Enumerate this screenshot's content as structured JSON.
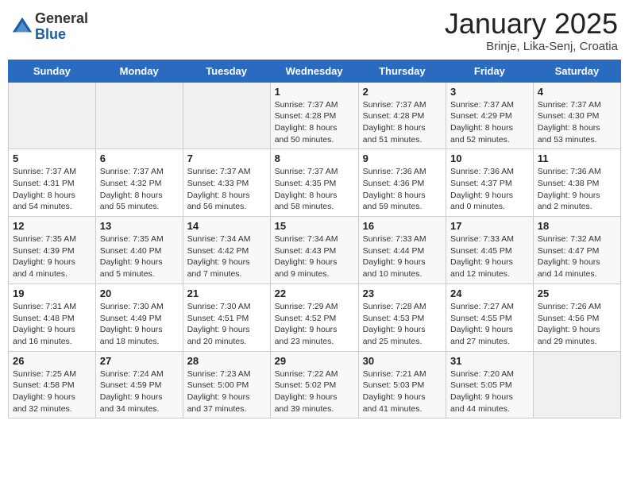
{
  "logo": {
    "general": "General",
    "blue": "Blue"
  },
  "header": {
    "title": "January 2025",
    "subtitle": "Brinje, Lika-Senj, Croatia"
  },
  "weekdays": [
    "Sunday",
    "Monday",
    "Tuesday",
    "Wednesday",
    "Thursday",
    "Friday",
    "Saturday"
  ],
  "weeks": [
    [
      {
        "day": "",
        "info": ""
      },
      {
        "day": "",
        "info": ""
      },
      {
        "day": "",
        "info": ""
      },
      {
        "day": "1",
        "info": "Sunrise: 7:37 AM\nSunset: 4:28 PM\nDaylight: 8 hours\nand 50 minutes."
      },
      {
        "day": "2",
        "info": "Sunrise: 7:37 AM\nSunset: 4:28 PM\nDaylight: 8 hours\nand 51 minutes."
      },
      {
        "day": "3",
        "info": "Sunrise: 7:37 AM\nSunset: 4:29 PM\nDaylight: 8 hours\nand 52 minutes."
      },
      {
        "day": "4",
        "info": "Sunrise: 7:37 AM\nSunset: 4:30 PM\nDaylight: 8 hours\nand 53 minutes."
      }
    ],
    [
      {
        "day": "5",
        "info": "Sunrise: 7:37 AM\nSunset: 4:31 PM\nDaylight: 8 hours\nand 54 minutes."
      },
      {
        "day": "6",
        "info": "Sunrise: 7:37 AM\nSunset: 4:32 PM\nDaylight: 8 hours\nand 55 minutes."
      },
      {
        "day": "7",
        "info": "Sunrise: 7:37 AM\nSunset: 4:33 PM\nDaylight: 8 hours\nand 56 minutes."
      },
      {
        "day": "8",
        "info": "Sunrise: 7:37 AM\nSunset: 4:35 PM\nDaylight: 8 hours\nand 58 minutes."
      },
      {
        "day": "9",
        "info": "Sunrise: 7:36 AM\nSunset: 4:36 PM\nDaylight: 8 hours\nand 59 minutes."
      },
      {
        "day": "10",
        "info": "Sunrise: 7:36 AM\nSunset: 4:37 PM\nDaylight: 9 hours\nand 0 minutes."
      },
      {
        "day": "11",
        "info": "Sunrise: 7:36 AM\nSunset: 4:38 PM\nDaylight: 9 hours\nand 2 minutes."
      }
    ],
    [
      {
        "day": "12",
        "info": "Sunrise: 7:35 AM\nSunset: 4:39 PM\nDaylight: 9 hours\nand 4 minutes."
      },
      {
        "day": "13",
        "info": "Sunrise: 7:35 AM\nSunset: 4:40 PM\nDaylight: 9 hours\nand 5 minutes."
      },
      {
        "day": "14",
        "info": "Sunrise: 7:34 AM\nSunset: 4:42 PM\nDaylight: 9 hours\nand 7 minutes."
      },
      {
        "day": "15",
        "info": "Sunrise: 7:34 AM\nSunset: 4:43 PM\nDaylight: 9 hours\nand 9 minutes."
      },
      {
        "day": "16",
        "info": "Sunrise: 7:33 AM\nSunset: 4:44 PM\nDaylight: 9 hours\nand 10 minutes."
      },
      {
        "day": "17",
        "info": "Sunrise: 7:33 AM\nSunset: 4:45 PM\nDaylight: 9 hours\nand 12 minutes."
      },
      {
        "day": "18",
        "info": "Sunrise: 7:32 AM\nSunset: 4:47 PM\nDaylight: 9 hours\nand 14 minutes."
      }
    ],
    [
      {
        "day": "19",
        "info": "Sunrise: 7:31 AM\nSunset: 4:48 PM\nDaylight: 9 hours\nand 16 minutes."
      },
      {
        "day": "20",
        "info": "Sunrise: 7:30 AM\nSunset: 4:49 PM\nDaylight: 9 hours\nand 18 minutes."
      },
      {
        "day": "21",
        "info": "Sunrise: 7:30 AM\nSunset: 4:51 PM\nDaylight: 9 hours\nand 20 minutes."
      },
      {
        "day": "22",
        "info": "Sunrise: 7:29 AM\nSunset: 4:52 PM\nDaylight: 9 hours\nand 23 minutes."
      },
      {
        "day": "23",
        "info": "Sunrise: 7:28 AM\nSunset: 4:53 PM\nDaylight: 9 hours\nand 25 minutes."
      },
      {
        "day": "24",
        "info": "Sunrise: 7:27 AM\nSunset: 4:55 PM\nDaylight: 9 hours\nand 27 minutes."
      },
      {
        "day": "25",
        "info": "Sunrise: 7:26 AM\nSunset: 4:56 PM\nDaylight: 9 hours\nand 29 minutes."
      }
    ],
    [
      {
        "day": "26",
        "info": "Sunrise: 7:25 AM\nSunset: 4:58 PM\nDaylight: 9 hours\nand 32 minutes."
      },
      {
        "day": "27",
        "info": "Sunrise: 7:24 AM\nSunset: 4:59 PM\nDaylight: 9 hours\nand 34 minutes."
      },
      {
        "day": "28",
        "info": "Sunrise: 7:23 AM\nSunset: 5:00 PM\nDaylight: 9 hours\nand 37 minutes."
      },
      {
        "day": "29",
        "info": "Sunrise: 7:22 AM\nSunset: 5:02 PM\nDaylight: 9 hours\nand 39 minutes."
      },
      {
        "day": "30",
        "info": "Sunrise: 7:21 AM\nSunset: 5:03 PM\nDaylight: 9 hours\nand 41 minutes."
      },
      {
        "day": "31",
        "info": "Sunrise: 7:20 AM\nSunset: 5:05 PM\nDaylight: 9 hours\nand 44 minutes."
      },
      {
        "day": "",
        "info": ""
      }
    ]
  ]
}
